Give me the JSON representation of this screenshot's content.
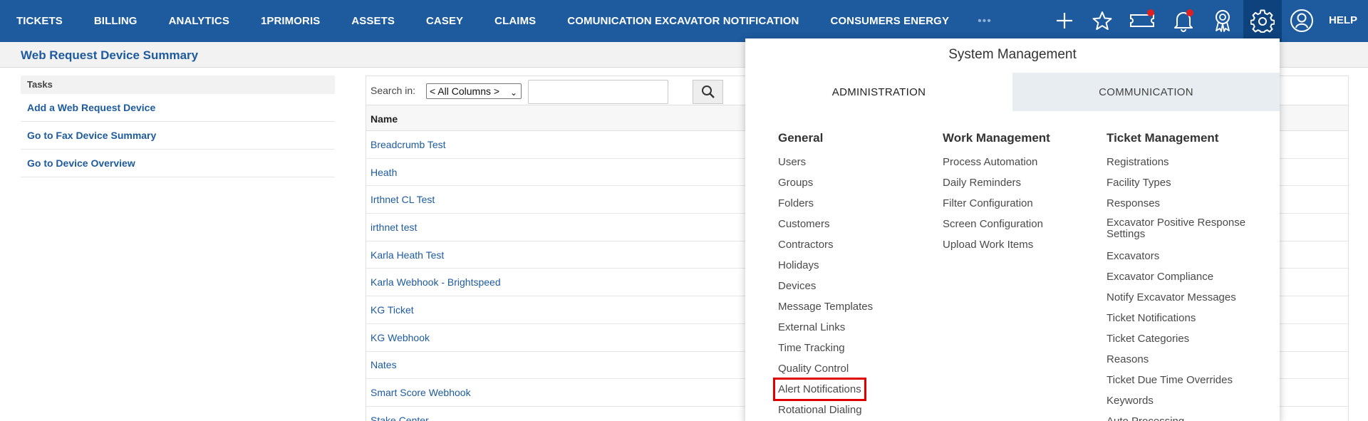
{
  "nav": {
    "items": [
      "TICKETS",
      "BILLING",
      "ANALYTICS",
      "1PRIMORIS",
      "ASSETS",
      "CASEY",
      "CLAIMS",
      "COMUNICATION EXCAVATOR NOTIFICATION",
      "CONSUMERS ENERGY"
    ],
    "more": "•••",
    "help": "HELP"
  },
  "page": {
    "title": "Web Request Device Summary"
  },
  "tasks": {
    "heading": "Tasks",
    "links": [
      "Add a Web Request Device",
      "Go to Fax Device Summary",
      "Go to Device Overview"
    ]
  },
  "grid": {
    "search_label": "Search in:",
    "column_select": "< All Columns >",
    "search_value": "",
    "header_name": "Name",
    "rows": [
      "Breadcrumb Test",
      "Heath",
      "Irthnet CL Test",
      "irthnet test",
      "Karla Heath Test",
      "Karla Webhook - Brightspeed",
      "KG Ticket",
      "KG Webhook",
      "Nates",
      "Smart Score Webhook",
      "Stake Center"
    ]
  },
  "system_management": {
    "title": "System Management",
    "tabs": [
      "ADMINISTRATION",
      "COMMUNICATION"
    ],
    "general": {
      "title": "General",
      "links": [
        "Users",
        "Groups",
        "Folders",
        "Customers",
        "Contractors",
        "Holidays",
        "Devices",
        "Message Templates",
        "External Links",
        "Time Tracking",
        "Quality Control",
        "Alert Notifications",
        "Rotational Dialing"
      ]
    },
    "work_management": {
      "title": "Work Management",
      "links": [
        "Process Automation",
        "Daily Reminders",
        "Filter Configuration",
        "Screen Configuration",
        "Upload Work Items"
      ]
    },
    "ticket_management": {
      "title": "Ticket Management",
      "links": [
        "Registrations",
        "Facility Types",
        "Responses",
        "Excavator Positive Response Settings",
        "Excavators",
        "Excavator Compliance",
        "Notify Excavator Messages",
        "Ticket Notifications",
        "Ticket Categories",
        "Reasons",
        "Ticket Due Time Overrides",
        "Keywords",
        "Auto Processing"
      ]
    }
  },
  "colors": {
    "nav_bg": "#1d5a9e",
    "active_icon_bg": "#0e427d",
    "link": "#1d5a9e",
    "highlight_box": "#e00000",
    "badge": "#e02020"
  }
}
